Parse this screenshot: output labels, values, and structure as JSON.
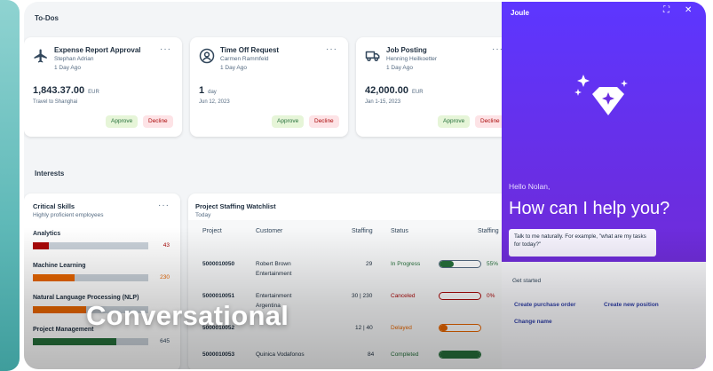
{
  "todos": {
    "title": "To-Dos",
    "cards": [
      {
        "title": "Expense Report Approval",
        "person": "Stephan Adrian",
        "age": "1 Day Ago",
        "amount": "1,843.37.00",
        "unit": "EUR",
        "sub": "Travel to Shanghai",
        "approve": "Approve",
        "decline": "Decline",
        "icon": "airplane-icon"
      },
      {
        "title": "Time Off Request",
        "person": "Carmen Rammfeld",
        "age": "1 Day Ago",
        "amount": "1",
        "unit": "day",
        "sub": "Jun 12, 2023",
        "approve": "Approve",
        "decline": "Decline",
        "icon": "person-icon"
      },
      {
        "title": "Job Posting",
        "person": "Henning Heilkoetter",
        "age": "1 Day Ago",
        "amount": "42,000.00",
        "unit": "EUR",
        "sub": "Jan 1-15, 2023",
        "approve": "Approve",
        "decline": "Decline",
        "icon": "truck-icon"
      }
    ]
  },
  "interests": {
    "title": "Interests"
  },
  "skills": {
    "title": "Critical Skills",
    "subtitle": "Highly proficient employees",
    "items": [
      {
        "name": "Analytics",
        "value": "43",
        "fill": 0.14,
        "color": "#aa0808"
      },
      {
        "name": "Machine Learning",
        "value": "230",
        "fill": 0.36,
        "color": "#e76500"
      },
      {
        "name": "Natural Language Processing (NLP)",
        "value": "",
        "fill": 0.46,
        "color": "#e76500"
      },
      {
        "name": "Project Management",
        "value": "645",
        "fill": 0.72,
        "color": "#256f3a"
      }
    ]
  },
  "staffing": {
    "title": "Project Staffing Watchlist",
    "subtitle": "Today",
    "headers": [
      "Project",
      "Customer",
      "Staffing",
      "Status",
      "Staffing"
    ],
    "rows": [
      {
        "project": "5000010050",
        "customer": "Robert Brown",
        "customer2": "Entertainment",
        "staffing": "29",
        "status": "In Progress",
        "status_color": "#256f3a",
        "progress": 0.35,
        "pct": "55%",
        "bar_color": "#256f3a"
      },
      {
        "project": "5000010051",
        "customer": "Entertainment",
        "customer2": "Argentina",
        "staffing": "30 | 230",
        "status": "Canceled",
        "status_color": "#aa0808",
        "progress": 0.0,
        "pct": "0%",
        "bar_color": "#aa0808"
      },
      {
        "project": "5000010052",
        "customer": "",
        "customer2": "",
        "staffing": "12 | 40",
        "status": "Delayed",
        "status_color": "#e76500",
        "progress": 0.2,
        "pct": "",
        "bar_color": "#e76500"
      },
      {
        "project": "5000010053",
        "customer": "Quinica Vodafonos",
        "customer2": "",
        "staffing": "84",
        "status": "Completed",
        "status_color": "#256f3a",
        "progress": 1.0,
        "pct": "",
        "bar_color": "#256f3a"
      }
    ]
  },
  "joule": {
    "title": "Joule",
    "hello": "Hello Nolan,",
    "headline": "How can I help you?",
    "bubble": "Talk to me naturally. For example, \"what are my tasks for today?\"",
    "get_started": "Get started",
    "chips": [
      "Create purchase order",
      "Create new position",
      "Change name"
    ]
  },
  "caption": "Conversational"
}
